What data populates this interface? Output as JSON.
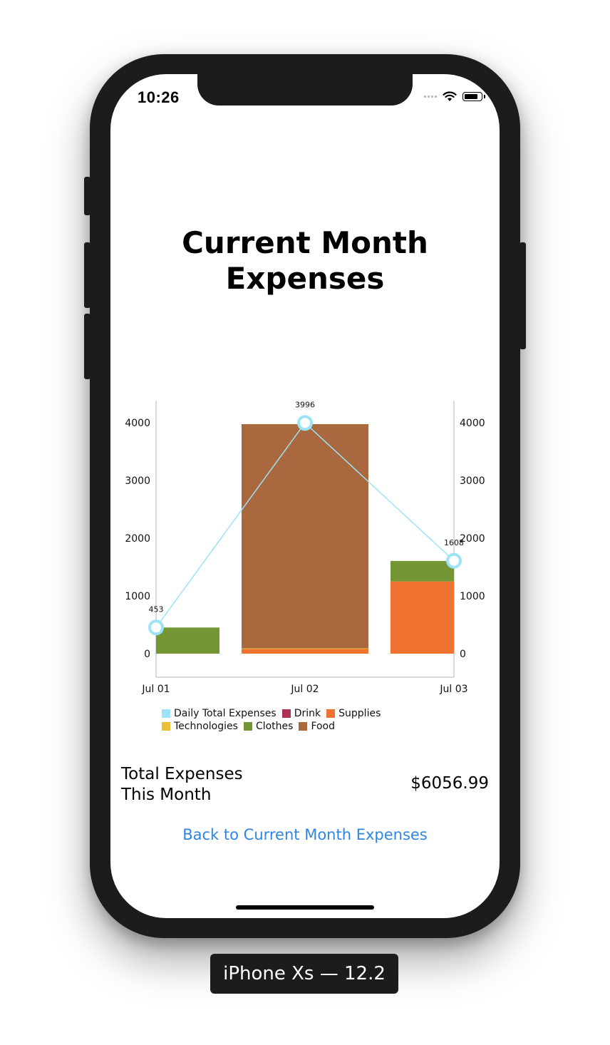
{
  "status_bar": {
    "time": "10:26"
  },
  "page": {
    "title_line1": "Current Month",
    "title_line2": "Expenses"
  },
  "chart_data": {
    "type": "bar",
    "stacked": true,
    "categories": [
      "Jul 01",
      "Jul 02",
      "Jul 03"
    ],
    "yticks": [
      "0",
      "1000",
      "2000",
      "3000",
      "4000"
    ],
    "ylim": [
      0,
      4000
    ],
    "series": [
      {
        "name": "Drink",
        "color": "#b03252",
        "values": [
          0,
          0,
          0
        ]
      },
      {
        "name": "Supplies",
        "color": "#ef7230",
        "values": [
          0,
          80,
          1250
        ]
      },
      {
        "name": "Technologies",
        "color": "#e8c036",
        "values": [
          0,
          12,
          0
        ]
      },
      {
        "name": "Clothes",
        "color": "#759635",
        "values": [
          453,
          0,
          356
        ]
      },
      {
        "name": "Food",
        "color": "#a9683e",
        "values": [
          0,
          3883,
          0
        ]
      }
    ],
    "line_series": {
      "name": "Daily Total Expenses",
      "color": "#9de3f7",
      "values": [
        453,
        3996,
        1608
      ]
    },
    "point_labels": [
      "453",
      "3996",
      "1608"
    ],
    "legend": [
      {
        "name": "Daily Total Expenses",
        "color": "#9de3f7"
      },
      {
        "name": "Drink",
        "color": "#b03252"
      },
      {
        "name": "Supplies",
        "color": "#ef7230"
      },
      {
        "name": "Technologies",
        "color": "#e8c036"
      },
      {
        "name": "Clothes",
        "color": "#759635"
      },
      {
        "name": "Food",
        "color": "#a9683e"
      }
    ],
    "legend_position": "bottom",
    "grid": false
  },
  "summary": {
    "total_label_line1": "Total Expenses",
    "total_label_line2": "This Month",
    "total_value": "$6056.99"
  },
  "actions": {
    "back_label": "Back to Current Month Expenses"
  },
  "device": {
    "label": "iPhone Xs — 12.2"
  }
}
